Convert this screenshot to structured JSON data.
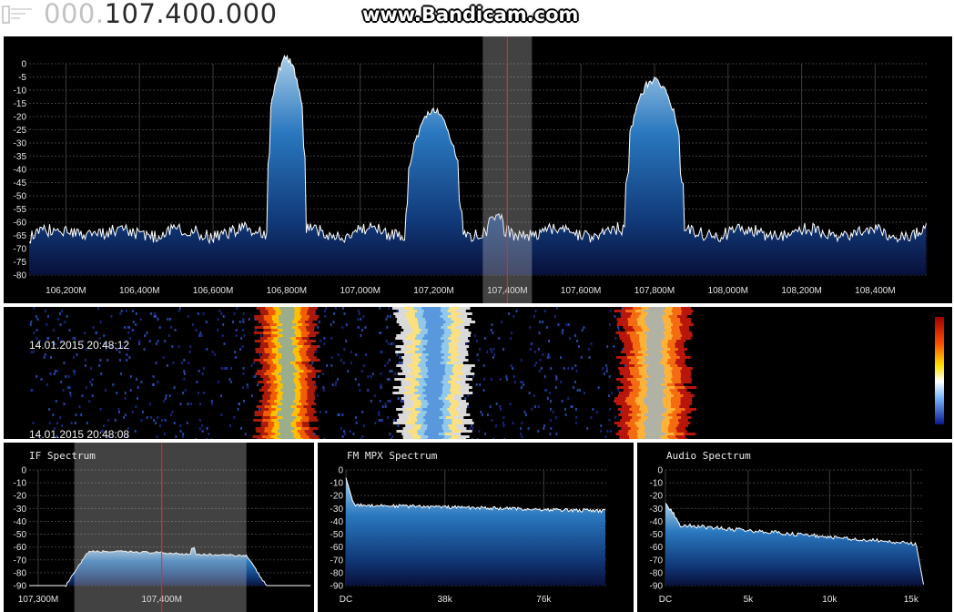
{
  "header": {
    "frequency_dim": "000.",
    "frequency_main": "107.400.000",
    "watermark": "www.Bandicam.com"
  },
  "spectrum": {
    "y_ticks": [
      "0",
      "-5",
      "-10",
      "-15",
      "-20",
      "-25",
      "-30",
      "-35",
      "-40",
      "-45",
      "-50",
      "-55",
      "-60",
      "-65",
      "-70",
      "-75",
      "-80"
    ],
    "x_ticks": [
      "106,200M",
      "106,400M",
      "106,600M",
      "106,800M",
      "107,000M",
      "107,200M",
      "107,400M",
      "107,600M",
      "107,800M",
      "108,000M",
      "108,200M",
      "108,400M"
    ],
    "tuned_frequency_mhz": 107.4,
    "signals_mhz": [
      106.8,
      107.2,
      107.8
    ]
  },
  "waterfall": {
    "timestamp_top": "14.01.2015 20:48:12",
    "timestamp_bottom": "14.01.2015 20:48:08"
  },
  "if_spectrum": {
    "title": "IF Spectrum",
    "y_ticks": [
      "0",
      "-10",
      "-20",
      "-30",
      "-40",
      "-50",
      "-60",
      "-70",
      "-80",
      "-90"
    ],
    "x_ticks": [
      "107,300M",
      "107,400M"
    ]
  },
  "mpx_spectrum": {
    "title": "FM MPX Spectrum",
    "y_ticks": [
      "0",
      "-10",
      "-20",
      "-30",
      "-40",
      "-50",
      "-60",
      "-70",
      "-80",
      "-90"
    ],
    "x_ticks": [
      "DC",
      "38k",
      "76k"
    ]
  },
  "audio_spectrum": {
    "title": "Audio Spectrum",
    "y_ticks": [
      "0",
      "-10",
      "-20",
      "-30",
      "-40",
      "-50",
      "-60",
      "-70",
      "-80",
      "-90"
    ],
    "x_ticks": [
      "DC",
      "5k",
      "10k",
      "15k"
    ]
  },
  "colors": {
    "panel_bg": "#000000",
    "trace": "#ffffff",
    "fill_top": "#7fb2dc",
    "fill_bottom": "#08103a",
    "grid": "#3c3c3c",
    "cursor": "#ff2020"
  }
}
